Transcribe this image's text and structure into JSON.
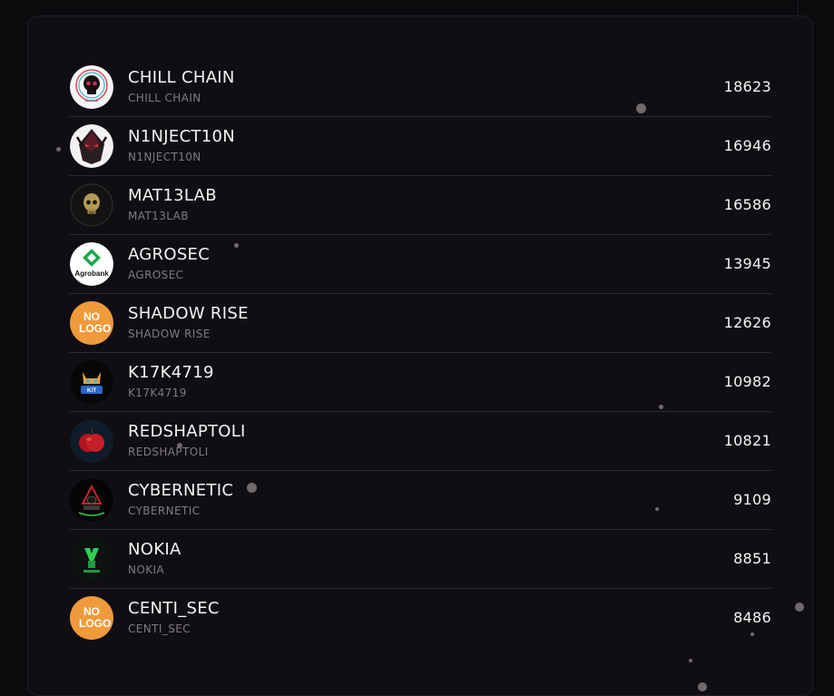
{
  "leaderboard": {
    "rows": [
      {
        "name": "CHILL CHAIN",
        "subtitle": "CHILL CHAIN",
        "score": "18623",
        "logo_icon": "chill-chain-skull-logo"
      },
      {
        "name": "N1NJECT10N",
        "subtitle": "N1NJECT10N",
        "score": "16946",
        "logo_icon": "hooded-ninja-logo"
      },
      {
        "name": "MAT13LAB",
        "subtitle": "MAT13LAB",
        "score": "16586",
        "logo_icon": "golden-skull-logo"
      },
      {
        "name": "AGROSEC",
        "subtitle": "AGROSEC",
        "score": "13945",
        "logo_icon": "agrobank-logo",
        "logo_text": "Agrobank"
      },
      {
        "name": "SHADOW RISE",
        "subtitle": "SHADOW RISE",
        "score": "12626",
        "logo_icon": "no-logo-placeholder",
        "logo_text": "NO LOGO"
      },
      {
        "name": "K17K4719",
        "subtitle": "K17K4719",
        "score": "10982",
        "logo_icon": "cat-mascot-logo"
      },
      {
        "name": "REDSHAPTOLI",
        "subtitle": "REDSHAPTOLI",
        "score": "10821",
        "logo_icon": "red-apple-logo"
      },
      {
        "name": "CYBERNETIC",
        "subtitle": "CYBERNETIC",
        "score": "9109",
        "logo_icon": "hacker-hood-logo"
      },
      {
        "name": "NOKIA",
        "subtitle": "NOKIA",
        "score": "8851",
        "logo_icon": "green-nokia-logo"
      },
      {
        "name": "CENTI_SEC",
        "subtitle": "CENTI_SEC",
        "score": "8486",
        "logo_icon": "no-logo-placeholder",
        "logo_text": "NO LOGO"
      }
    ]
  },
  "colors": {
    "background": "#0b0a0d",
    "panel": "#110e13",
    "divider": "#2b282e",
    "muted_text": "#7e7a82",
    "no_logo_orange": "#ef9a3b"
  }
}
